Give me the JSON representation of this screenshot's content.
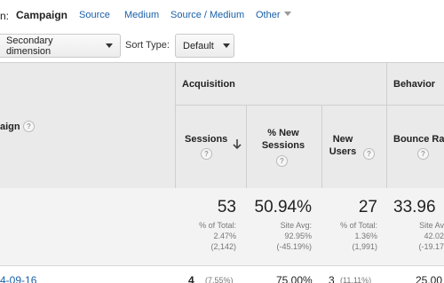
{
  "dimension_bar": {
    "prefix": "n:",
    "active": "Campaign",
    "links": [
      "Source",
      "Medium",
      "Source / Medium"
    ],
    "other": "Other"
  },
  "controls": {
    "secondary_dimension": "Secondary dimension",
    "sort_type_label": "Sort Type:",
    "sort_type_value": "Default"
  },
  "table": {
    "first_col_header": "aign",
    "groups": {
      "acquisition": "Acquisition",
      "behavior": "Behavior"
    },
    "columns": {
      "sessions": "Sessions",
      "new_sessions": [
        "% New",
        "Sessions"
      ],
      "new_users": [
        "New",
        "Users"
      ],
      "bounce_rate": "Bounce Ra"
    },
    "help_glyph": "?",
    "totals": {
      "sessions": {
        "value": "53",
        "line1": "% of Total:",
        "line2": "2.47%",
        "line3": "(2,142)"
      },
      "new_sessions": {
        "value": "50.94%",
        "line1": "Site Avg:",
        "line2": "92.95%",
        "line3": "(-45.19%)"
      },
      "new_users": {
        "value": "27",
        "line1": "% of Total:",
        "line2": "1.36%",
        "line3": "(1,991)"
      },
      "bounce_rate": {
        "value": "33.96",
        "line1": "Site Av",
        "line2": "42.02",
        "line3": "(-19.17"
      }
    },
    "row1": {
      "label": "4-09-16",
      "sessions": "4",
      "sessions_pct": "(7.55%)",
      "new_sessions": "75.00%",
      "new_users": "3",
      "new_users_pct": "(11.11%)",
      "bounce_rate": "25.00"
    }
  }
}
